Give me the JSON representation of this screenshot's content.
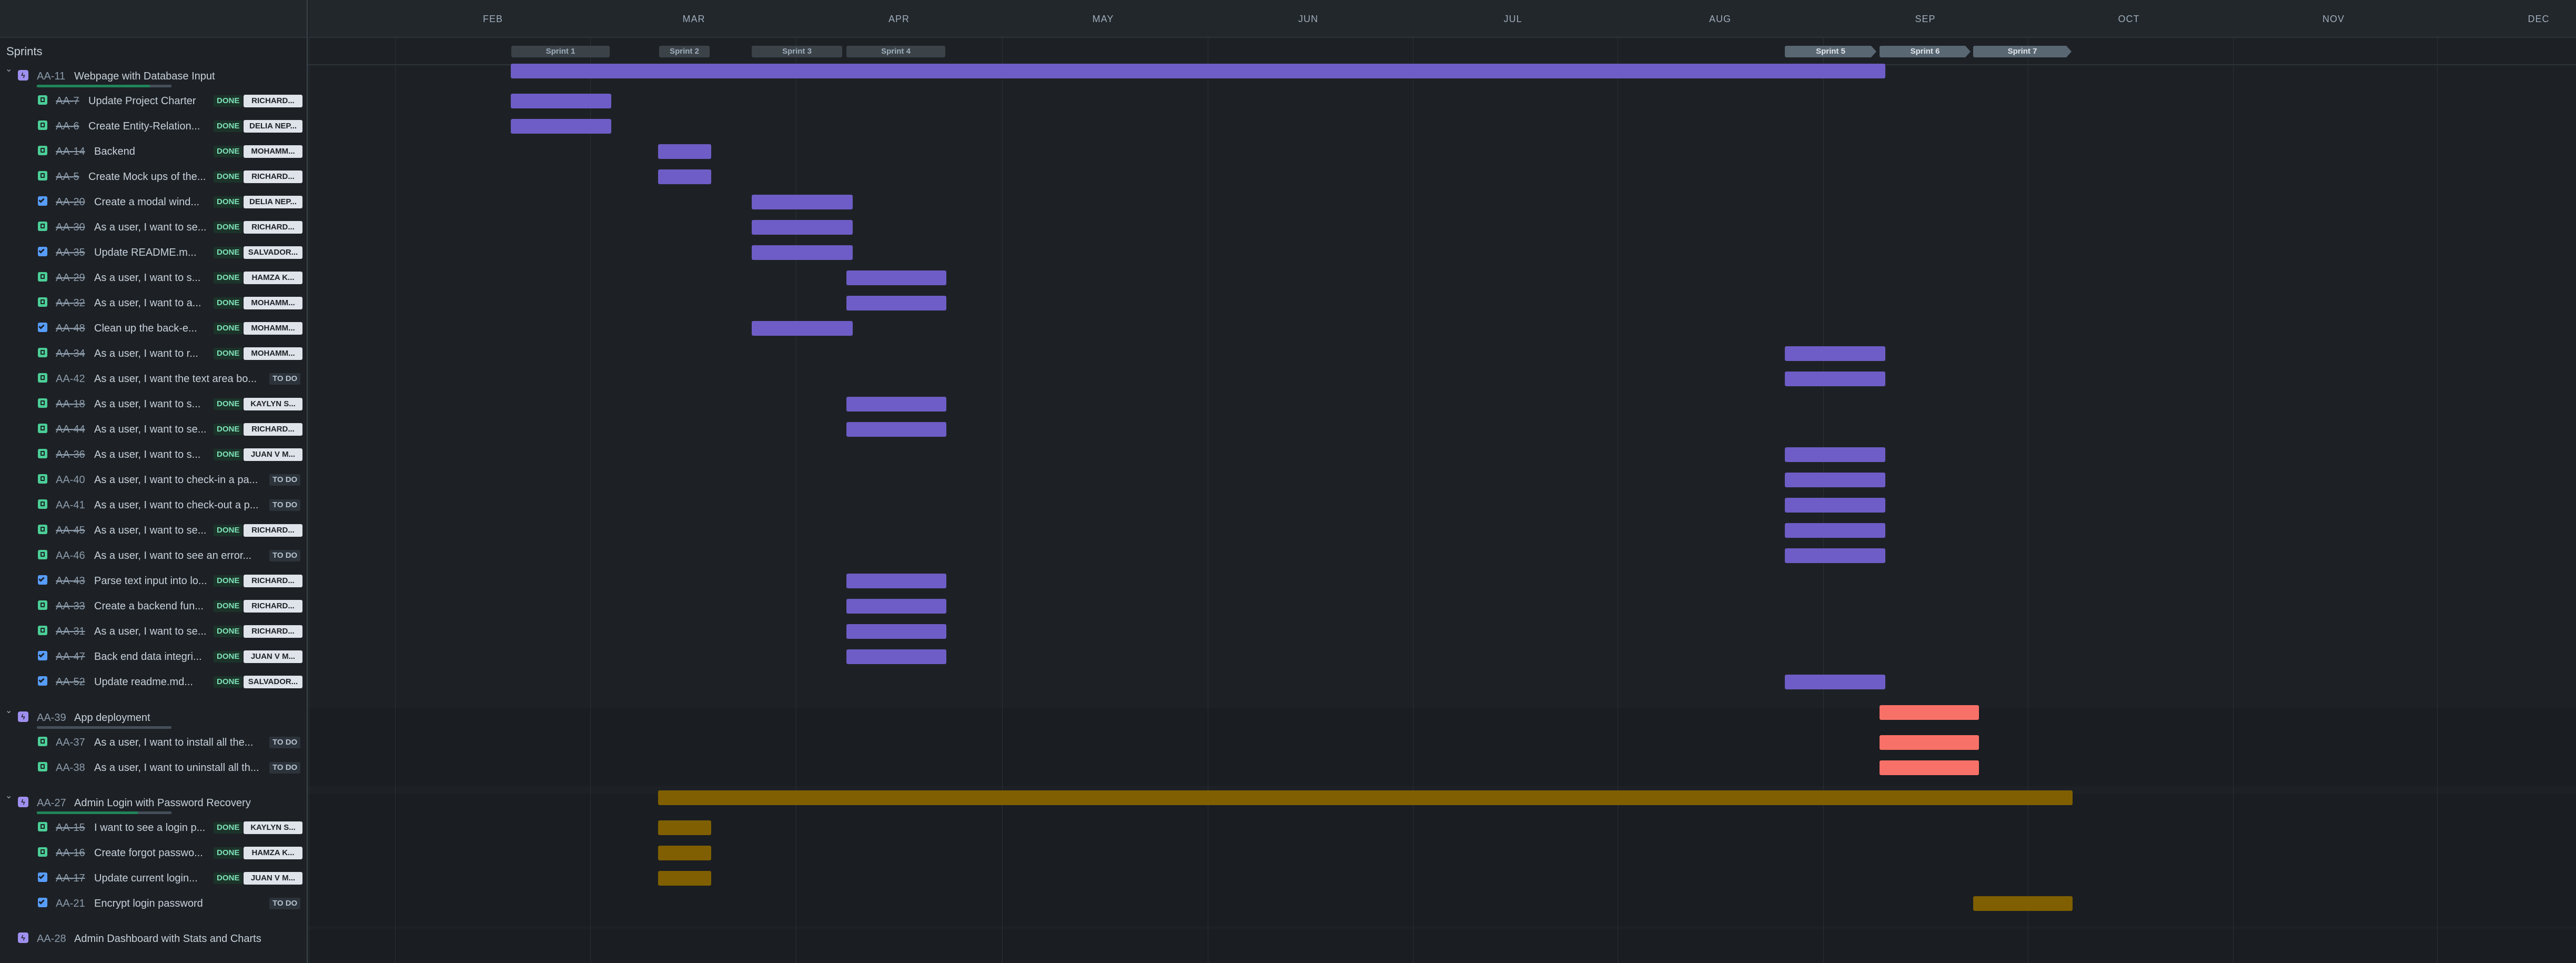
{
  "sprints_label": "Sprints",
  "months": [
    "FEB",
    "MAR",
    "APR",
    "MAY",
    "JUN",
    "JUL",
    "AUG",
    "SEP",
    "OCT",
    "NOV",
    "DEC"
  ],
  "sprints": [
    {
      "label": "Sprint 1",
      "active": false
    },
    {
      "label": "Sprint 2",
      "active": false
    },
    {
      "label": "Sprint 3",
      "active": false
    },
    {
      "label": "Sprint 4",
      "active": false
    },
    {
      "label": "Sprint 5",
      "active": true
    },
    {
      "label": "Sprint 6",
      "active": true
    },
    {
      "label": "Sprint 7",
      "active": true
    }
  ],
  "colors": {
    "violet": "#6e5dc6",
    "red": "#f87168",
    "gold": "#7f5f01",
    "done_badge": "#1c3329",
    "epic_icon": "#9f8fef"
  },
  "epics": [
    {
      "key": "AA-11",
      "title": "Webpage with Database Input",
      "expanded": true,
      "color": "violet",
      "progress": 0.84,
      "children": [
        {
          "type": "story",
          "key": "AA-7",
          "title": "Update Project Charter",
          "status": "DONE",
          "assignee": "RICHARD..."
        },
        {
          "type": "story",
          "key": "AA-6",
          "title": "Create Entity-Relation...",
          "status": "DONE",
          "assignee": "DELIA NEP..."
        },
        {
          "type": "story",
          "key": "AA-14",
          "title": "Backend",
          "status": "DONE",
          "assignee": "MOHAMM..."
        },
        {
          "type": "story",
          "key": "AA-5",
          "title": "Create Mock ups of the...",
          "status": "DONE",
          "assignee": "RICHARD..."
        },
        {
          "type": "task",
          "key": "AA-20",
          "title": "Create a modal wind...",
          "status": "DONE",
          "assignee": "DELIA NEP..."
        },
        {
          "type": "story",
          "key": "AA-30",
          "title": "As a user, I want to se...",
          "status": "DONE",
          "assignee": "RICHARD..."
        },
        {
          "type": "task",
          "key": "AA-35",
          "title": "Update README.m...",
          "status": "DONE",
          "assignee": "SALVADOR..."
        },
        {
          "type": "story",
          "key": "AA-29",
          "title": "As a user, I want to s...",
          "status": "DONE",
          "assignee": "HAMZA K..."
        },
        {
          "type": "story",
          "key": "AA-32",
          "title": "As a user, I want to a...",
          "status": "DONE",
          "assignee": "MOHAMM..."
        },
        {
          "type": "task",
          "key": "AA-48",
          "title": "Clean up the back-e...",
          "status": "DONE",
          "assignee": "MOHAMM..."
        },
        {
          "type": "story",
          "key": "AA-34",
          "title": "As a user, I want to r...",
          "status": "DONE",
          "assignee": "MOHAMM..."
        },
        {
          "type": "story",
          "key": "AA-42",
          "title": "As a user, I want the text area bo...",
          "status": "TO DO",
          "assignee": ""
        },
        {
          "type": "story",
          "key": "AA-18",
          "title": "As a user, I want to s...",
          "status": "DONE",
          "assignee": "KAYLYN S..."
        },
        {
          "type": "story",
          "key": "AA-44",
          "title": "As a user, I want to se...",
          "status": "DONE",
          "assignee": "RICHARD..."
        },
        {
          "type": "story",
          "key": "AA-36",
          "title": "As a user, I want to s...",
          "status": "DONE",
          "assignee": "JUAN V M..."
        },
        {
          "type": "story",
          "key": "AA-40",
          "title": "As a user, I want to check-in a pa...",
          "status": "TO DO",
          "assignee": ""
        },
        {
          "type": "story",
          "key": "AA-41",
          "title": "As a user, I want to check-out a p...",
          "status": "TO DO",
          "assignee": ""
        },
        {
          "type": "story",
          "key": "AA-45",
          "title": "As a user, I want to se...",
          "status": "DONE",
          "assignee": "RICHARD..."
        },
        {
          "type": "story",
          "key": "AA-46",
          "title": "As a user, I want to see an error...",
          "status": "TO DO",
          "assignee": ""
        },
        {
          "type": "task",
          "key": "AA-43",
          "title": "Parse text input into lo...",
          "status": "DONE",
          "assignee": "RICHARD..."
        },
        {
          "type": "story",
          "key": "AA-33",
          "title": "Create a backend fun...",
          "status": "DONE",
          "assignee": "RICHARD..."
        },
        {
          "type": "story",
          "key": "AA-31",
          "title": "As a user, I want to se...",
          "status": "DONE",
          "assignee": "RICHARD..."
        },
        {
          "type": "task",
          "key": "AA-47",
          "title": "Back end data integri...",
          "status": "DONE",
          "assignee": "JUAN V M..."
        },
        {
          "type": "task",
          "key": "AA-52",
          "title": "Update readme.md...",
          "status": "DONE",
          "assignee": "SALVADOR..."
        }
      ]
    },
    {
      "key": "AA-39",
      "title": "App deployment",
      "expanded": true,
      "color": "red",
      "progress": 0,
      "children": [
        {
          "type": "story",
          "key": "AA-37",
          "title": "As a user, I want to install all the...",
          "status": "TO DO",
          "assignee": ""
        },
        {
          "type": "story",
          "key": "AA-38",
          "title": "As a user, I want to uninstall all th...",
          "status": "TO DO",
          "assignee": ""
        }
      ]
    },
    {
      "key": "AA-27",
      "title": "Admin Login with Password Recovery",
      "expanded": true,
      "color": "gold",
      "progress": 0.75,
      "children": [
        {
          "type": "story",
          "key": "AA-15",
          "title": "I want to see a login p...",
          "status": "DONE",
          "assignee": "KAYLYN S..."
        },
        {
          "type": "story",
          "key": "AA-16",
          "title": "Create forgot passwo...",
          "status": "DONE",
          "assignee": "HAMZA K..."
        },
        {
          "type": "task",
          "key": "AA-17",
          "title": "Update current login...",
          "status": "DONE",
          "assignee": "JUAN V M..."
        },
        {
          "type": "task",
          "key": "AA-21",
          "title": "Encrypt login password",
          "status": "TO DO",
          "assignee": ""
        }
      ]
    },
    {
      "key": "AA-28",
      "title": "Admin Dashboard with Stats and Charts",
      "expanded": false,
      "color": "violet",
      "progress": 0,
      "children": []
    }
  ]
}
